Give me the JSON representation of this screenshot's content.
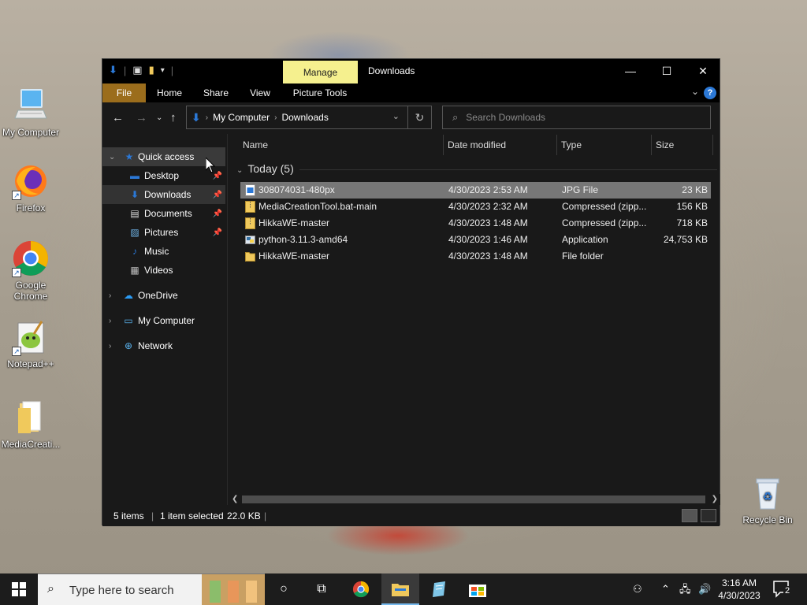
{
  "desktop": {
    "icons": [
      {
        "label": "My Computer",
        "icon": "computer-icon"
      },
      {
        "label": "Firefox",
        "icon": "firefox-icon"
      },
      {
        "label": "Google Chrome",
        "icon": "chrome-icon"
      },
      {
        "label": "Notepad++",
        "icon": "notepadpp-icon"
      },
      {
        "label": "MediaCreati...",
        "icon": "folder-icon"
      },
      {
        "label": "Recycle Bin",
        "icon": "recycle-bin-icon"
      }
    ]
  },
  "window": {
    "title": "Downloads",
    "context_tab": "Manage",
    "ribbon_tabs": [
      "File",
      "Home",
      "Share",
      "View",
      "Picture Tools"
    ],
    "colors": {
      "file_tab": "#9b6d1c",
      "manage_tab": "#f5f08e",
      "accent": "#2b78d6"
    }
  },
  "address": {
    "crumbs": [
      "My Computer",
      "Downloads"
    ]
  },
  "search": {
    "placeholder": "Search Downloads"
  },
  "nav": {
    "quick_access": "Quick access",
    "items": [
      "Desktop",
      "Downloads",
      "Documents",
      "Pictures",
      "Music",
      "Videos"
    ],
    "roots": [
      "OneDrive",
      "My Computer",
      "Network"
    ]
  },
  "columns": {
    "name": "Name",
    "date": "Date modified",
    "type": "Type",
    "size": "Size"
  },
  "group": {
    "label": "Today (5)"
  },
  "files": [
    {
      "name": "308074031-480px",
      "date": "4/30/2023 2:53 AM",
      "type": "JPG File",
      "size": "23 KB"
    },
    {
      "name": "MediaCreationTool.bat-main",
      "date": "4/30/2023 2:32 AM",
      "type": "Compressed (zipp...",
      "size": "156 KB"
    },
    {
      "name": "HikkaWE-master",
      "date": "4/30/2023 1:48 AM",
      "type": "Compressed (zipp...",
      "size": "718 KB"
    },
    {
      "name": "python-3.11.3-amd64",
      "date": "4/30/2023 1:46 AM",
      "type": "Application",
      "size": "24,753 KB"
    },
    {
      "name": "HikkaWE-master",
      "date": "4/30/2023 1:48 AM",
      "type": "File folder",
      "size": ""
    }
  ],
  "status": {
    "items": "5 items",
    "selected": "1 item selected",
    "size": "22.0 KB"
  },
  "taskbar": {
    "search_placeholder": "Type here to search",
    "time": "3:16 AM",
    "date": "4/30/2023",
    "notifications": "2"
  }
}
